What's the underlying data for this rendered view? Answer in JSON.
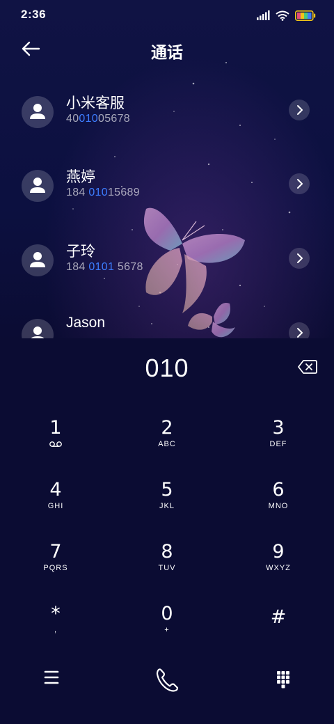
{
  "status": {
    "time": "2:36"
  },
  "header": {
    "title": "通话"
  },
  "contacts": [
    {
      "name": "小米客服",
      "number_pre": "40",
      "number_hl": "010",
      "number_post": "05678"
    },
    {
      "name": "燕婷",
      "number_pre": "184 ",
      "number_hl": "010",
      "number_post": "15689"
    },
    {
      "name": "子玲",
      "number_pre": "184 ",
      "number_hl": "0101",
      "number_post": " 5678"
    },
    {
      "name": "Jason",
      "number_pre": "",
      "number_hl": "",
      "number_post": ""
    }
  ],
  "dialer": {
    "display": "010",
    "keys": [
      {
        "digit": "1",
        "letters": ""
      },
      {
        "digit": "2",
        "letters": "ABC"
      },
      {
        "digit": "3",
        "letters": "DEF"
      },
      {
        "digit": "4",
        "letters": "GHI"
      },
      {
        "digit": "5",
        "letters": "JKL"
      },
      {
        "digit": "6",
        "letters": "MNO"
      },
      {
        "digit": "7",
        "letters": "PQRS"
      },
      {
        "digit": "8",
        "letters": "TUV"
      },
      {
        "digit": "9",
        "letters": "WXYZ"
      },
      {
        "digit": "*",
        "letters": ","
      },
      {
        "digit": "0",
        "letters": "+"
      },
      {
        "digit": "#",
        "letters": ""
      }
    ]
  },
  "icons": {
    "back": "arrow-left-icon",
    "backspace": "backspace-icon",
    "voicemail": "voicemail-icon",
    "menu": "menu-icon",
    "call": "phone-icon",
    "keypad": "keypad-icon"
  },
  "colors": {
    "background": "#0b0c33",
    "highlight": "#3d7dff",
    "battery": "#f0c419"
  }
}
